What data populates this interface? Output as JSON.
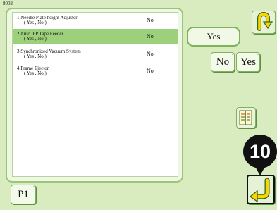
{
  "screen": {
    "id": "8002"
  },
  "settings": [
    {
      "name": "1 Needle Plate height Adjuster",
      "options": "( Yes , No )",
      "value": "No",
      "selected": false
    },
    {
      "name": "2 Auto. PP Tape Feeder",
      "options": "( Yes , No )",
      "value": "No",
      "selected": true
    },
    {
      "name": "3 Synchronized Vacuum System",
      "options": "( Yes , No )",
      "value": "No",
      "selected": false
    },
    {
      "name": "4 Frame Ejector",
      "options": "( Yes , No )",
      "value": "No",
      "selected": false
    }
  ],
  "current_value": "Yes",
  "keys": {
    "no": "No",
    "yes": "Yes"
  },
  "page": {
    "label": "P1"
  },
  "marker": {
    "label": "10"
  },
  "icons": {
    "back": "u-turn-arrow-icon",
    "manual": "manual-book-icon",
    "enter": "enter-arrow-icon",
    "accent": "#ffd200"
  },
  "colors": {
    "background": "#d9ecc0",
    "selected_row": "#9cd07a",
    "border": "#7fb25a"
  }
}
